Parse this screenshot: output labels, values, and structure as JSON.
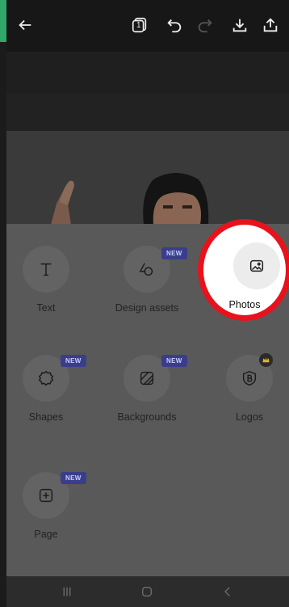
{
  "topbar": {
    "icons": [
      "back-arrow-icon",
      "pages-icon",
      "undo-icon",
      "redo-icon",
      "download-icon",
      "share-icon"
    ],
    "pages_count": "1"
  },
  "menu": {
    "items": [
      {
        "name": "text",
        "label": "Text",
        "icon": "text-icon",
        "badge": ""
      },
      {
        "name": "design-assets",
        "label": "Design assets",
        "icon": "design-assets-icon",
        "badge": "NEW"
      },
      {
        "name": "photos",
        "label": "Photos",
        "icon": "photo-icon",
        "badge": ""
      },
      {
        "name": "shapes",
        "label": "Shapes",
        "icon": "shapes-icon",
        "badge": "NEW"
      },
      {
        "name": "backgrounds",
        "label": "Backgrounds",
        "icon": "backgrounds-icon",
        "badge": "NEW"
      },
      {
        "name": "logos",
        "label": "Logos",
        "icon": "logo-icon",
        "badge": "crown-icon"
      },
      {
        "name": "page",
        "label": "Page",
        "icon": "add-page-icon",
        "badge": "NEW"
      }
    ]
  },
  "colors": {
    "accent_green": "#2fa86b",
    "highlight_ring": "#e8121c",
    "badge_bg": "#3a3e8a",
    "crown": "#e2b12a"
  },
  "navbar": {
    "icons": [
      "recents-icon",
      "home-icon",
      "back-icon"
    ]
  }
}
